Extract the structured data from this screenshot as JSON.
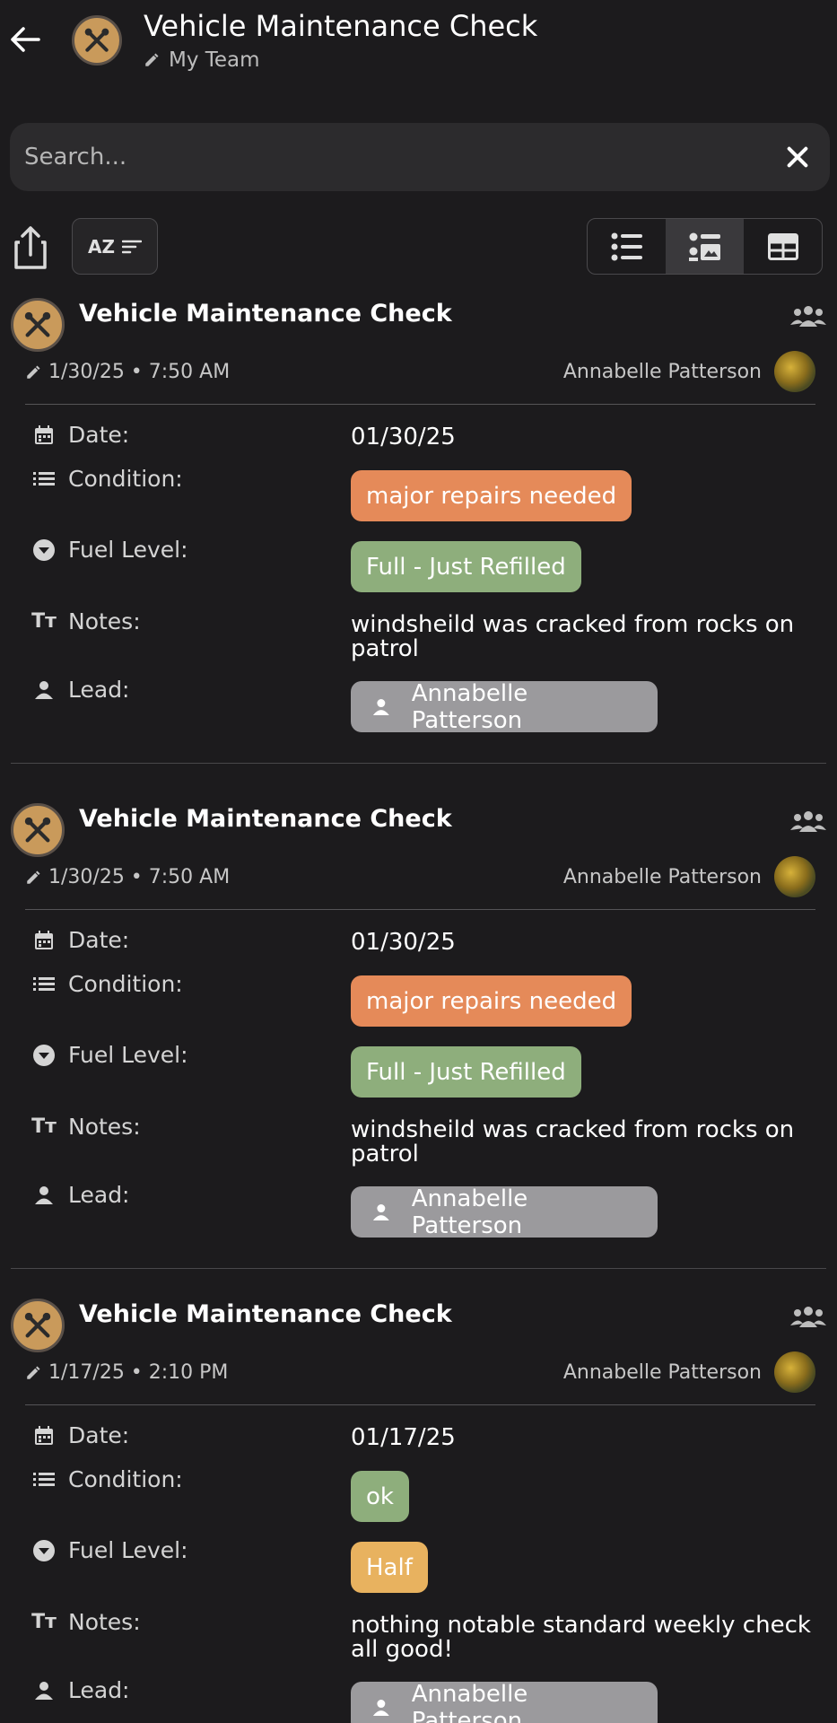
{
  "header": {
    "title": "Vehicle Maintenance Check",
    "subtitle": "My Team"
  },
  "search": {
    "placeholder": "Search...",
    "value": ""
  },
  "toolbar": {
    "sort_icon_text": "AZ",
    "view_modes": [
      "list",
      "card",
      "table"
    ],
    "active_view": "card"
  },
  "colors": {
    "background": "#1c1b1d",
    "app_icon": "#c99a5b",
    "chip_orange": "#e58a59",
    "chip_green": "#8eae7c",
    "chip_yellow": "#e8b25f",
    "chip_gray": "#9b9a9d"
  },
  "field_labels": {
    "date": "Date:",
    "condition": "Condition:",
    "fuel": "Fuel Level:",
    "notes": "Notes:",
    "lead": "Lead:"
  },
  "records": [
    {
      "title": "Vehicle Maintenance Check",
      "meta": "1/30/25 • 7:50 AM",
      "author": "Annabelle Patterson",
      "date": "01/30/25",
      "condition": "major repairs needed",
      "fuel": "Full - Just Refilled",
      "notes": "windsheild was cracked from rocks on patrol",
      "lead": "Annabelle Patterson"
    },
    {
      "title": "Vehicle Maintenance Check",
      "meta": "1/30/25 • 7:50 AM",
      "author": "Annabelle Patterson",
      "date": "01/30/25",
      "condition": "major repairs needed",
      "fuel": "Full - Just Refilled",
      "notes": "windsheild was cracked from rocks on patrol",
      "lead": "Annabelle Patterson"
    },
    {
      "title": "Vehicle Maintenance Check",
      "meta": "1/17/25 • 2:10 PM",
      "author": "Annabelle Patterson",
      "date": "01/17/25",
      "condition": "ok",
      "fuel": "Half",
      "notes": "nothing notable standard weekly check all good!",
      "lead": "Annabelle Patterson"
    }
  ]
}
